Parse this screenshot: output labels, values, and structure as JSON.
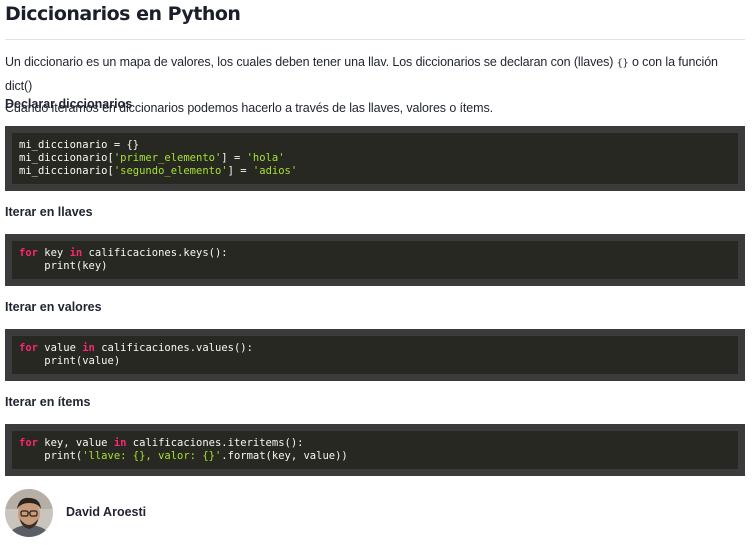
{
  "article": {
    "title": "Diccionarios en Python",
    "intro_line1_a": "Un diccionario es un mapa de valores, los cuales deben tener una llav. Los diccionarios se declaran con (llaves)",
    "intro_line1_code": "{}",
    "intro_line1_b": "o con la función dict()",
    "intro_line2": "Cuando iteramos en diccionarios podemos hacerlo a través de las llaves, valores o ítems.",
    "sections": [
      {
        "heading": "Declarar diccionarios",
        "code": [
          "mi_diccionario = {}",
          "mi_diccionario[",
          "'primer_elemento'",
          "] = ",
          "'hola'",
          "mi_diccionario[",
          "'segundo_elemento'",
          "] = ",
          "'adios'"
        ]
      },
      {
        "heading": "Iterar en llaves",
        "code": [
          "for",
          " key ",
          "in",
          " calificaciones.keys():",
          "    print(key)"
        ]
      },
      {
        "heading": "Iterar en valores",
        "code": [
          "for",
          " value ",
          "in",
          " calificaciones.values():",
          "    print(value)"
        ]
      },
      {
        "heading": "Iterar en ítems",
        "code": [
          "for",
          " key, value ",
          "in",
          " calificaciones.iteritems():",
          "    print(",
          "'llave: {}, valor: {}'",
          ".format(key, value))"
        ]
      }
    ]
  },
  "author": {
    "name": "David Aroesti"
  },
  "colors": {
    "code_bg": "#272822",
    "code_frame": "#3b3b3b",
    "keyword": "#f92672",
    "string": "#a6e22e"
  }
}
